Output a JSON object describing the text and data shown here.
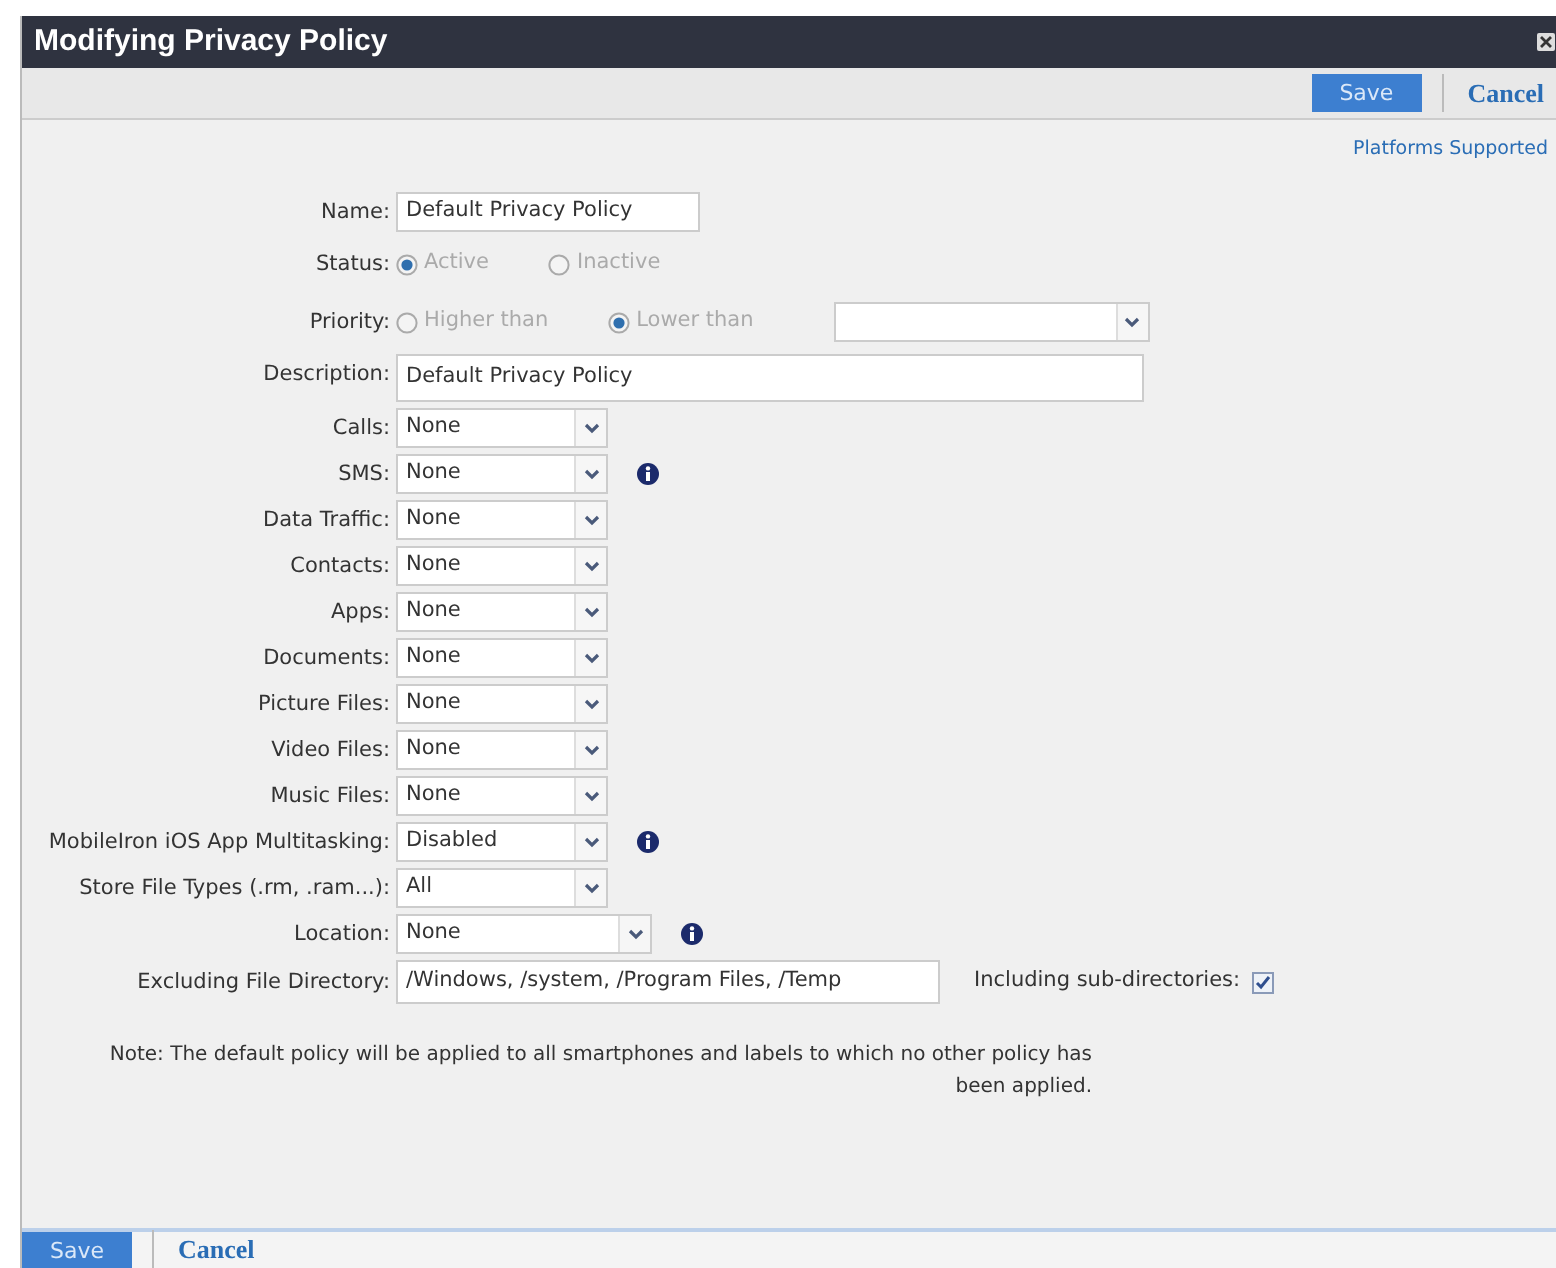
{
  "window": {
    "title": "Modifying Privacy Policy"
  },
  "toolbar": {
    "buttons": [
      {
        "label": "Save",
        "kind": "primary"
      },
      {
        "label": "Cancel",
        "kind": "link"
      }
    ]
  },
  "platforms_link": "Platforms Supported",
  "fields": [
    {
      "kind": "text",
      "label": "Name:",
      "value": "Default Privacy Policy"
    },
    {
      "kind": "radio",
      "label": "Status:",
      "options": [
        {
          "label": "Active",
          "selected": true
        },
        {
          "label": "Inactive",
          "selected": false
        }
      ]
    },
    {
      "kind": "radio_select",
      "label": "Priority:",
      "options": [
        {
          "label": "Higher than",
          "selected": false
        },
        {
          "label": "Lower than",
          "selected": true
        }
      ]
    },
    {
      "kind": "text_wide",
      "label": "Description:",
      "value": "Default Privacy Policy"
    },
    {
      "kind": "select",
      "label": "Calls:",
      "value": "None",
      "info": false
    },
    {
      "kind": "select",
      "label": "SMS:",
      "value": "None",
      "info": true
    },
    {
      "kind": "select",
      "label": "Data Traffic:",
      "value": "None",
      "info": false
    },
    {
      "kind": "select",
      "label": "Contacts:",
      "value": "None",
      "info": false
    },
    {
      "kind": "select",
      "label": "Apps:",
      "value": "None",
      "info": false
    },
    {
      "kind": "select",
      "label": "Documents:",
      "value": "None",
      "info": false
    },
    {
      "kind": "select",
      "label": "Picture Files:",
      "value": "None",
      "info": false
    },
    {
      "kind": "select",
      "label": "Video Files:",
      "value": "None",
      "info": false
    },
    {
      "kind": "select",
      "label": "Music Files:",
      "value": "None",
      "info": false
    },
    {
      "kind": "select",
      "label": "MobileIron iOS App Multitasking:",
      "value": "Disabled",
      "info": true
    },
    {
      "kind": "select",
      "label": "Store File Types (.rm, .ram...):",
      "value": "All",
      "info": false
    },
    {
      "kind": "select_wide",
      "label": "Location:",
      "value": "None",
      "info": true
    },
    {
      "kind": "directory",
      "label": "Excluding File Directory:",
      "value": "/Windows, /system, /Program Files, /Temp",
      "checkbox": {
        "label": "Including sub-directories:",
        "checked": true
      }
    }
  ],
  "note": "Note: The default policy will be applied to all smartphones and labels to which no other policy has been applied.",
  "footer": {
    "buttons": [
      {
        "label": "Save",
        "kind": "primary"
      },
      {
        "label": "Cancel",
        "kind": "link"
      }
    ]
  }
}
